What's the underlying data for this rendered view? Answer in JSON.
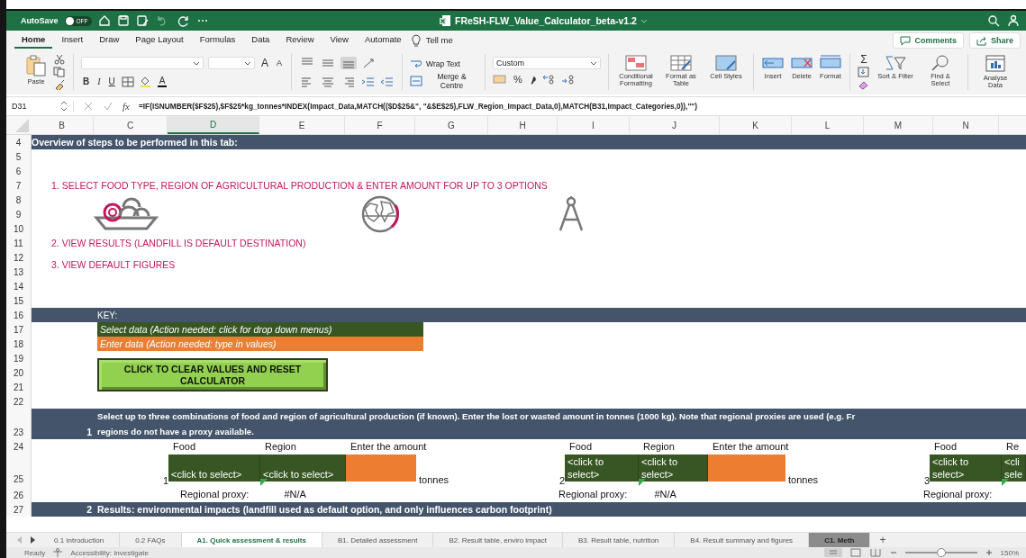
{
  "title_bar": {
    "autosave_label": "AutoSave",
    "autosave": {
      "on": false,
      "label": "OFF"
    },
    "title": "FReSH-FLW_Value_Calculator_beta-v1.2"
  },
  "ribbon_tabs": [
    {
      "label": "Home",
      "selected": true
    },
    {
      "label": "Insert",
      "selected": false
    },
    {
      "label": "Draw",
      "selected": false
    },
    {
      "label": "Page Layout",
      "selected": false
    },
    {
      "label": "Formulas",
      "selected": false
    },
    {
      "label": "Data",
      "selected": false
    },
    {
      "label": "Review",
      "selected": false
    },
    {
      "label": "View",
      "selected": false
    },
    {
      "label": "Automate",
      "selected": false
    }
  ],
  "tell_me": "Tell me",
  "comments": "Comments",
  "share": "Share",
  "ribbon": {
    "paste": "Paste",
    "font_grow": "A",
    "font_shrink": "A",
    "bold": "B",
    "italic": "I",
    "underline": "U",
    "font_color": "A",
    "vertical_align": [
      {
        "selected": false
      },
      {
        "selected": false
      },
      {
        "selected": true
      }
    ],
    "wrap_text": "Wrap Text",
    "merge": "Merge & Centre",
    "number_format": "Custom",
    "percent": "%",
    "style_buttons": [
      "Conditional Formatting",
      "Format as Table",
      "Cell Styles"
    ],
    "cell_buttons": [
      "Insert",
      "Delete",
      "Format"
    ],
    "autosum": "Σ",
    "sort_filter": "Sort & Filter",
    "find_select": "Find & Select",
    "analyse": "Analyse Data"
  },
  "formula_bar": {
    "name_box": "D31",
    "fx": "fx",
    "formula": "=IF(ISNUMBER($F$25),$F$25*kg_tonnes*INDEX(Impact_Data,MATCH(($D$25&\", \"&$E$25),FLW_Region_Impact_Data,0),MATCH(B31,Impact_Categories,0)),\"\")"
  },
  "columns": [
    {
      "label": "B",
      "selected": false
    },
    {
      "label": "C",
      "selected": false
    },
    {
      "label": "D",
      "selected": true
    },
    {
      "label": "E",
      "selected": false
    },
    {
      "label": "F",
      "selected": false
    },
    {
      "label": "G",
      "selected": false
    },
    {
      "label": "H",
      "selected": false
    },
    {
      "label": "I",
      "selected": false
    },
    {
      "label": "J",
      "selected": false
    },
    {
      "label": "K",
      "selected": false
    },
    {
      "label": "L",
      "selected": false
    },
    {
      "label": "M",
      "selected": false
    },
    {
      "label": "N",
      "selected": false
    }
  ],
  "row_numbers": [
    "4",
    "5",
    "6",
    "7",
    "8",
    "9",
    "10",
    "11",
    "12",
    "13",
    "14",
    "15",
    "16",
    "17",
    "18",
    "19",
    "20",
    "21",
    "22",
    "23",
    "24",
    "25",
    "26",
    "27"
  ],
  "sheet": {
    "overview_banner": "Overview of steps to be performed in this tab:",
    "steps": [
      "1. SELECT FOOD TYPE, REGION OF AGRICULTURAL PRODUCTION & ENTER AMOUNT FOR UP TO 3 OPTIONS",
      "2. VIEW RESULTS (LANDFILL IS DEFAULT DESTINATION)",
      "3. VIEW DEFAULT FIGURES"
    ],
    "key": {
      "title": "KEY:",
      "select": "Select data (Action needed: click for drop down menus)",
      "enter": "Enter data (Action needed: type in values)"
    },
    "reset_button": "CLICK TO CLEAR VALUES AND RESET CALCULATOR",
    "selection_header": {
      "number": "1",
      "lines": [
        "Select up to three combinations of food and region of agricultural production (if known). Enter the lost or wasted amount in tonnes (1000 kg). Note that regional proxies are used (e.g. Fr",
        "regions do not have a proxy available."
      ]
    },
    "options": [
      {
        "number": "1",
        "food_label": "Food",
        "region_label": "Region",
        "amount_label": "Enter the amount",
        "food": "<click to select>",
        "region": "<click to select>",
        "unit": "tonnes",
        "proxy_label": "Regional proxy:",
        "proxy_value": "#N/A"
      },
      {
        "number": "2",
        "food_label": "Food",
        "region_label": "Region",
        "amount_label": "Enter the amount",
        "food": "<click to select>",
        "region": "<click to select>",
        "unit": "tonnes",
        "proxy_label": "Regional proxy:",
        "proxy_value": "#N/A"
      },
      {
        "number": "3",
        "food_label": "Food",
        "region_label": "Re",
        "food": "<click to select>",
        "region": "<cli sele",
        "proxy_label": "Regional proxy:"
      }
    ],
    "results_banner": {
      "number": "2",
      "text": "Results: environmental impacts (landfill used as default option, and only influences carbon footprint)"
    }
  },
  "sheet_tabs": [
    {
      "label": "0.1 Introduction",
      "selected": false
    },
    {
      "label": "0.2 FAQs",
      "selected": false
    },
    {
      "label": "A1. Quick assessment & results",
      "selected": true
    },
    {
      "label": "B1. Detailed assessment",
      "selected": false
    },
    {
      "label": "B2. Result table, enviro impact",
      "selected": false
    },
    {
      "label": "B3. Result table, nutrition",
      "selected": false
    },
    {
      "label": "B4. Result summary and figures",
      "selected": false
    },
    {
      "label": "C1. Meth",
      "selected": false,
      "color": "#8c8c8c"
    }
  ],
  "add_sheet": "+",
  "status_bar": {
    "ready": "Ready",
    "accessibility": "Accessibility: Investigate",
    "zoom": {
      "level": 0.5
    },
    "zoom_label": "150%"
  }
}
